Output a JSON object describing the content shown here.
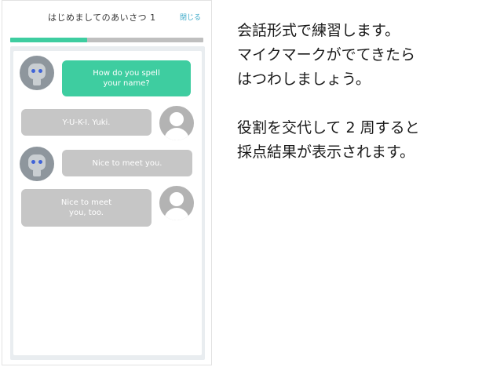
{
  "app": {
    "title": "はじめましてのあいさつ 1",
    "close_label": "閉じる",
    "progress": 0.4
  },
  "messages": [
    {
      "speaker": "robot",
      "text": "How do you spell\nyour name?",
      "icon": "robot-icon"
    },
    {
      "speaker": "user",
      "text": "Y-U-K-I.  Yuki.",
      "icon": "user-avatar-icon"
    },
    {
      "speaker": "robot",
      "text": "Nice to meet you.",
      "icon": "robot-icon"
    },
    {
      "speaker": "user",
      "text": "Nice to meet\nyou, too.",
      "icon": "user-avatar-icon"
    }
  ],
  "instructions": {
    "para1": [
      "会話形式で練習します。",
      "マイクマークがでてきたら",
      "はつわしましょう。"
    ],
    "para2": [
      "役割を交代して 2 周すると",
      "採点結果が表示されます。"
    ]
  },
  "colors": {
    "accent_green": "#3ecda0",
    "bubble_grey": "#c6c6c6",
    "link_blue": "#3aa8c8",
    "robot_eye": "#3f63d8"
  }
}
